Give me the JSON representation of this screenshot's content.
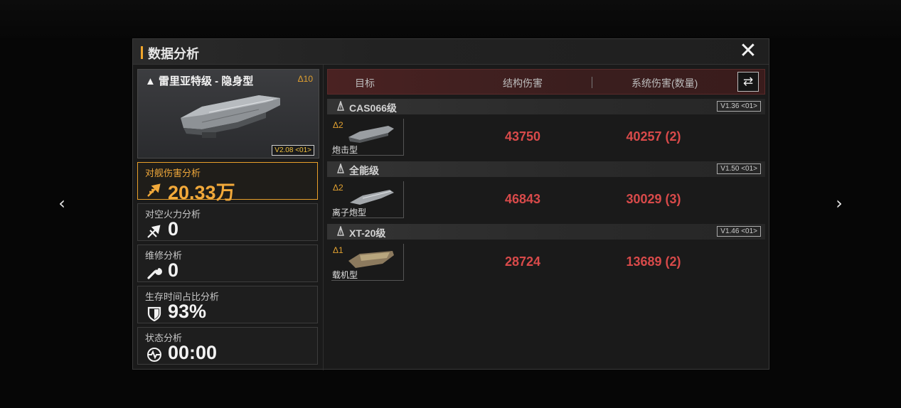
{
  "dialog": {
    "title": "数据分析"
  },
  "ship": {
    "name": "▲ 雷里亚特级 - 隐身型",
    "level": "Δ10",
    "version": "V2.08 <01>"
  },
  "stats": [
    {
      "label": "对舰伤害分析",
      "value": "20.33万",
      "icon": "ship-damage-icon"
    },
    {
      "label": "对空火力分析",
      "value": "0",
      "icon": "anti-air-icon"
    },
    {
      "label": "维修分析",
      "value": "0",
      "icon": "wrench-icon"
    },
    {
      "label": "生存时间占比分析",
      "value": "93%",
      "icon": "shield-icon"
    },
    {
      "label": "状态分析",
      "value": "00:00",
      "icon": "status-pulse-icon"
    }
  ],
  "table": {
    "headers": {
      "target": "目标",
      "structure": "结构伤害",
      "system": "系统伤害(数量)"
    },
    "groups": [
      {
        "name": "CAS066级",
        "version": "V1.36 <01>",
        "entry_level": "Δ2",
        "entry_type": "炮击型",
        "structure_damage": "43750",
        "system_damage": "40257 (2)"
      },
      {
        "name": "全能级",
        "version": "V1.50 <01>",
        "entry_level": "Δ2",
        "entry_type": "离子炮型",
        "structure_damage": "46843",
        "system_damage": "30029 (3)"
      },
      {
        "name": "XT-20级",
        "version": "V1.46 <01>",
        "entry_level": "Δ1",
        "entry_type": "载机型",
        "structure_damage": "28724",
        "system_damage": "13689 (2)"
      }
    ]
  },
  "nav": {
    "prev": "‹",
    "next": "›"
  },
  "colors": {
    "accent": "#f0a52a",
    "damage": "#d84a4a"
  }
}
